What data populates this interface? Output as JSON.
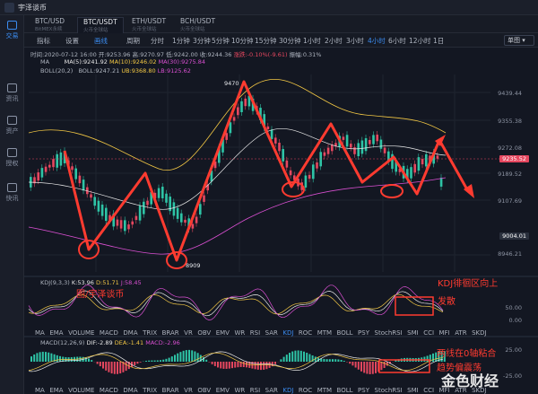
{
  "app": {
    "title": "宇泽谈币"
  },
  "sidebar": {
    "items": [
      {
        "label": "交易",
        "icon": "exchange-icon",
        "active": true
      },
      {
        "label": "资讯",
        "icon": "news-icon",
        "active": false
      },
      {
        "label": "资产",
        "icon": "wallet-icon",
        "active": false
      },
      {
        "label": "授权",
        "icon": "authorize-icon",
        "active": false
      },
      {
        "label": "快讯",
        "icon": "flash-news-icon",
        "active": false
      }
    ]
  },
  "market_tabs": [
    {
      "name": "BTC/USD",
      "sub": "BitMEX永续",
      "active": false
    },
    {
      "name": "BTC/USDT",
      "sub": "火币全球站",
      "active": true
    },
    {
      "name": "ETH/USDT",
      "sub": "火币全球站",
      "active": false
    },
    {
      "name": "BCH/USDT",
      "sub": "火币全球站",
      "active": false
    }
  ],
  "toolbar": {
    "left": [
      {
        "label": "指标",
        "active": false
      },
      {
        "label": "设置",
        "active": false
      },
      {
        "label": "画线",
        "active": true
      }
    ],
    "period_label": "周期",
    "periods": [
      "分时",
      "1分钟",
      "3分钟",
      "5分钟",
      "10分钟",
      "15分钟",
      "30分钟",
      "1小时",
      "2小时",
      "3小时",
      "4小时",
      "6小时",
      "12小时",
      "1日"
    ],
    "active_period": "4小时",
    "display_mode": "单图"
  },
  "ohlc_line": {
    "time": "时间:2020-07-12 16:00",
    "open": "开:9253.96",
    "high": "高:9270.97",
    "low": "低:9242.00",
    "close": "收:9244.36",
    "change": "涨跌:-0.10%(-9.61)",
    "amplitude": "振幅:0.31%"
  },
  "ma_line": {
    "name": "MA",
    "ma5": "MA(5):9241.92",
    "ma10": "MA(10):9246.02",
    "ma30": "MA(30):9275.84"
  },
  "boll_line": {
    "name": "BOLL(20,2)",
    "boll": "BOLL:9247.21",
    "ub": "UB:9368.80",
    "lb": "LB:9125.62"
  },
  "price_axis": [
    "9439.44",
    "9355.38",
    "9272.08",
    "9189.52",
    "9107.69",
    "9004.01",
    "8946.21"
  ],
  "current_price": "9235.52",
  "crosshair_price": "9004.01",
  "high_marker": "9470",
  "low_marker": "8909",
  "kdj_line": {
    "name": "KDJ(9,3,3)",
    "k": "K:53.96",
    "d": "D:51.71",
    "j": "J:58.45"
  },
  "kdj_axis": [
    "50.00",
    "0.00"
  ],
  "indicator_tabs": [
    "MA",
    "EMA",
    "VOLUME",
    "MACD",
    "DMA",
    "TRIX",
    "BRAR",
    "VR",
    "OBV",
    "EMV",
    "WR",
    "RSI",
    "SAR",
    "KDJ",
    "ROC",
    "MTM",
    "BOLL",
    "PSY",
    "StochRSI",
    "SMI",
    "CCI",
    "MFI",
    "ATR",
    "SKDJ"
  ],
  "indicator_tabs_active": "KDJ",
  "macd_line": {
    "name": "MACD(12,26,9)",
    "dif": "DIF:-2.89",
    "dea": "DEA:-1.41",
    "macd": "MACD:-2.96"
  },
  "macd_axis": [
    "25.00",
    "-25.00"
  ],
  "annotations": {
    "kdj_note_1": "KDJ徘徊区向上",
    "kdj_note_2": "发散",
    "macd_note_1": "两线在0轴粘合",
    "macd_note_2": "趋势偏震荡",
    "source_caption": "图/宇泽谈币"
  },
  "watermark": {
    "text": "金色财经"
  },
  "colors": {
    "up": "#2ec4a6",
    "down": "#e5475f",
    "accent": "#3b8cf0",
    "annotation": "#ff3b30",
    "ma5": "#e8e8e8",
    "ma10": "#f2c744",
    "ma30": "#d94fd1"
  }
}
